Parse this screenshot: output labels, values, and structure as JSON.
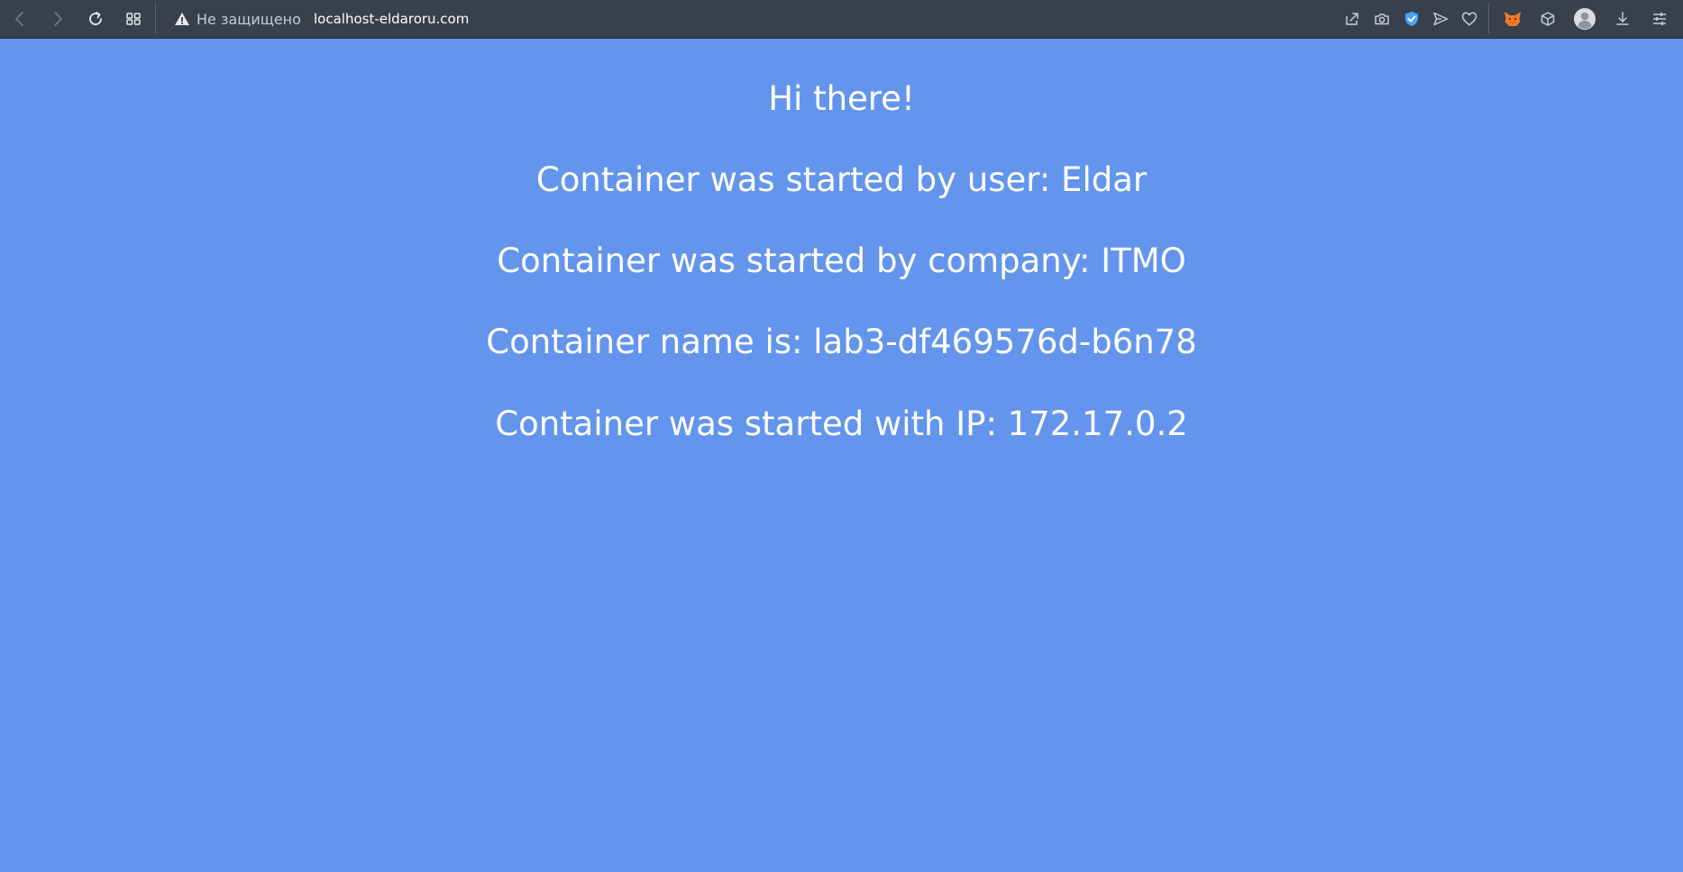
{
  "browser": {
    "security_label": "Не защищено",
    "url": "localhost-eldaroru.com",
    "toolbar_colors": {
      "background": "#38404c",
      "icon": "#c7ccd4",
      "vpn_badge": "#4aa3ff",
      "fox_extension": "#f07a2a"
    },
    "nav_icons": [
      "back-icon",
      "forward-icon",
      "reload-icon",
      "tabs-grid-icon"
    ],
    "right_icons": [
      "share-icon",
      "camera-icon",
      "shield-check-icon",
      "send-icon",
      "heart-icon",
      "fox-extension-icon",
      "cube-icon",
      "avatar-icon",
      "download-icon",
      "settings-sliders-icon"
    ]
  },
  "page": {
    "background": "#6495ed",
    "greeting": "Hi there!",
    "started_by_user": "Container was started by user: Eldar",
    "started_by_company": "Container was started by company: ITMO",
    "container_name": "Container name is: lab3-df469576d-b6n78",
    "container_ip": "Container was started with IP: 172.17.0.2"
  }
}
